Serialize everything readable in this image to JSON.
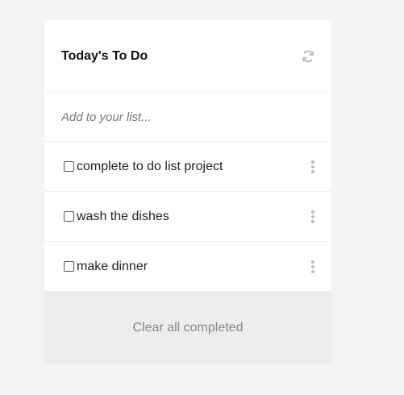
{
  "header": {
    "title": "Today's To Do",
    "refresh_icon": "refresh-icon"
  },
  "add": {
    "placeholder": "Add to your list..."
  },
  "items": [
    {
      "label": "complete to do list project",
      "checked": false
    },
    {
      "label": "wash the dishes",
      "checked": false
    },
    {
      "label": "make dinner",
      "checked": false
    }
  ],
  "footer": {
    "clear_label": "Clear all completed"
  },
  "colors": {
    "background": "#f4f4f4",
    "card": "#ffffff",
    "footer": "#ededed",
    "icon": "#bcbcbc"
  }
}
